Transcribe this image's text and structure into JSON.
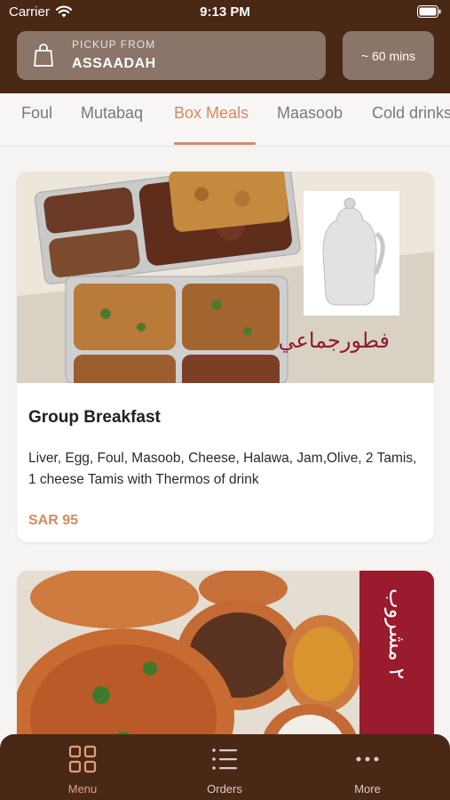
{
  "status_bar": {
    "carrier": "Carrier",
    "time": "9:13 PM"
  },
  "header": {
    "pickup_label": "PICKUP FROM",
    "pickup_location": "ASSAADAH",
    "time_estimate": "~ 60 mins"
  },
  "tabs": [
    {
      "label": "Foul"
    },
    {
      "label": "Mutabaq"
    },
    {
      "label": "Box Meals",
      "active": true
    },
    {
      "label": "Maasoob"
    },
    {
      "label": "Cold drinks"
    }
  ],
  "items": [
    {
      "image_caption_arabic": "فطورجماعي",
      "title": "Group Breakfast",
      "description": "Liver, Egg, Foul, Masoob, Cheese, Halawa, Jam,Olive, 2 Tamis, 1 cheese Tamis with Thermos of drink",
      "price": "SAR 95"
    },
    {
      "image_caption_arabic": "٢ مشروب"
    }
  ],
  "bottom_nav": [
    {
      "label": "Menu",
      "icon": "grid-icon",
      "active": true
    },
    {
      "label": "Orders",
      "icon": "list-icon"
    },
    {
      "label": "More",
      "icon": "more-dots-icon"
    }
  ],
  "colors": {
    "brand_dark": "#4a2816",
    "accent": "#d48a62",
    "header_box": "#8b7468"
  }
}
